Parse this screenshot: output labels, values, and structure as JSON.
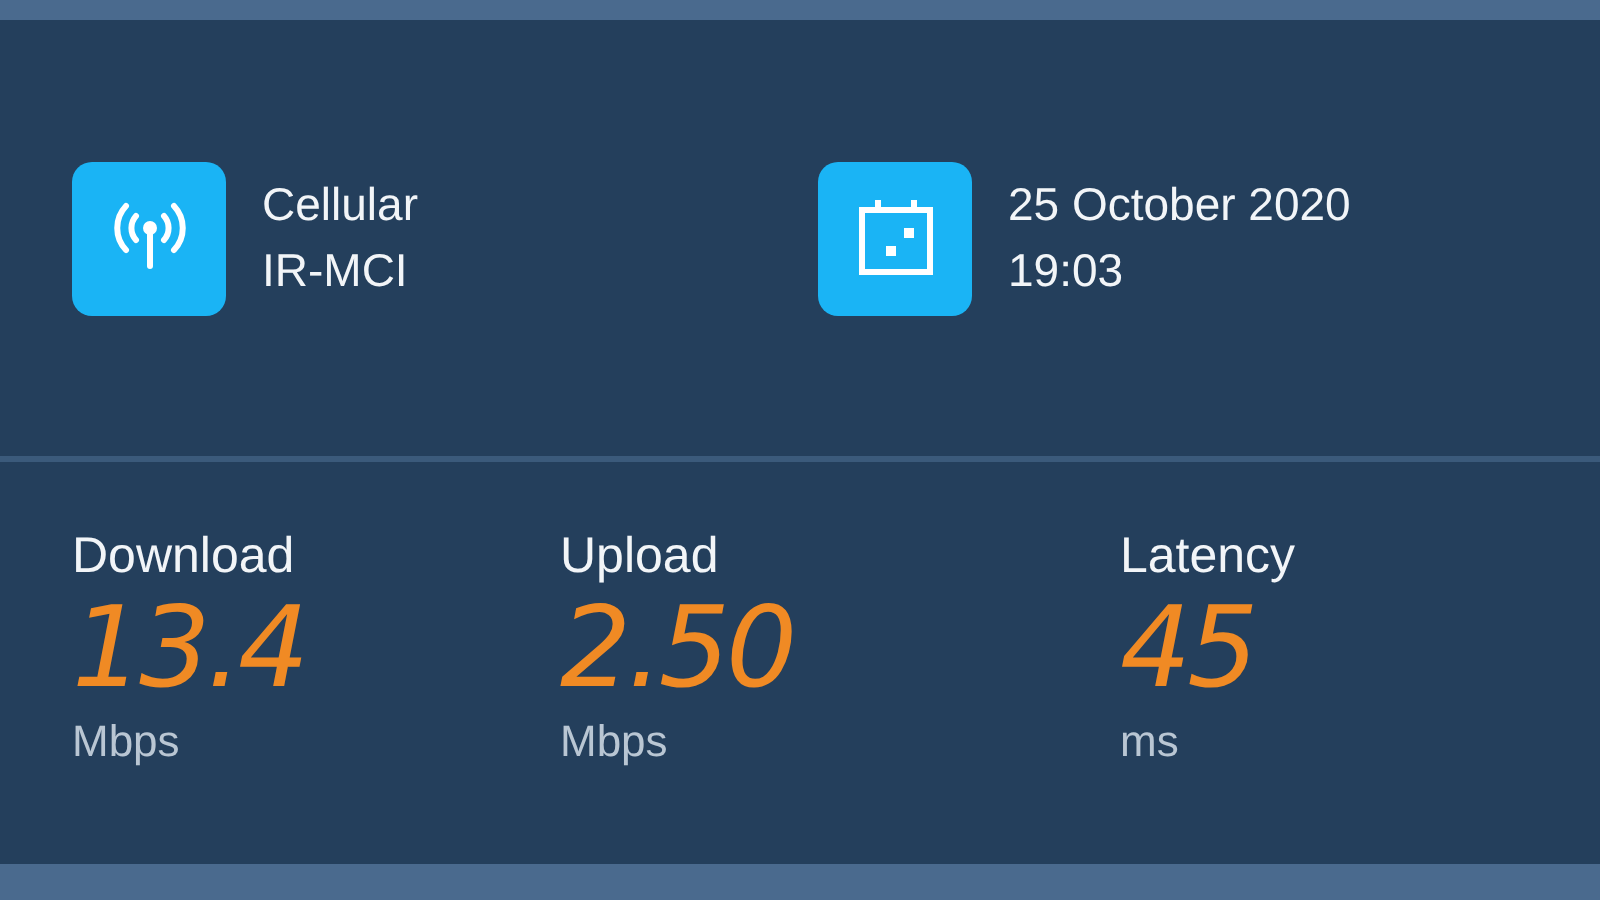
{
  "info": [
    {
      "kind": "network",
      "line_1": "Cellular",
      "line_2": "IR-MCI"
    },
    {
      "kind": "calendar",
      "line_1": "25 October 2020",
      "line_2": "19:03"
    }
  ],
  "stats": [
    {
      "label": "Download",
      "value": "13.4",
      "unit": "Mbps"
    },
    {
      "label": "Upload",
      "value": "2.50",
      "unit": "Mbps"
    },
    {
      "label": "Latency",
      "value": "45",
      "unit": "ms"
    }
  ]
}
